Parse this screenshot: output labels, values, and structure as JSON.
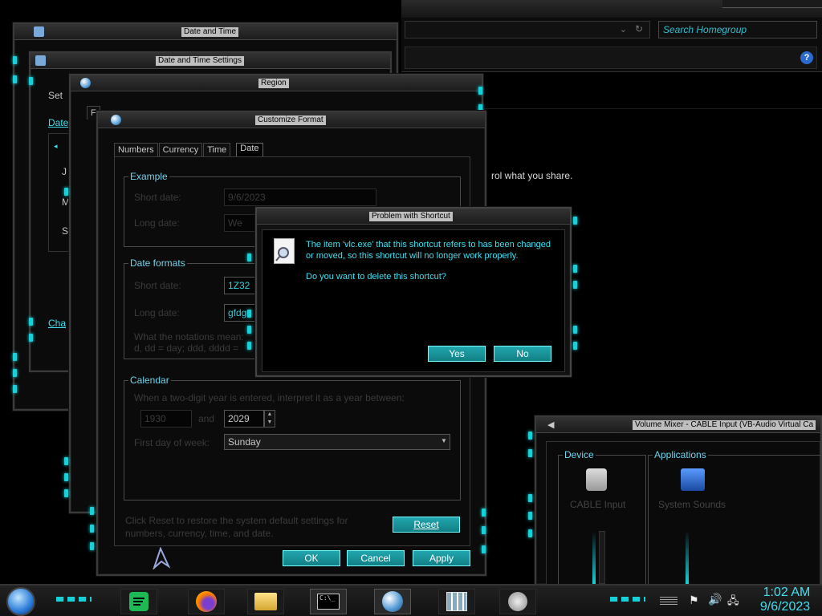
{
  "explorer": {
    "search_placeholder": "Search Homegroup",
    "share_text": "rol what you share."
  },
  "windows": {
    "date_time": {
      "title": "Date and Time"
    },
    "date_time_settings": {
      "title": "Date and Time Settings",
      "left_label_1": "Set",
      "left_label_2": "Date",
      "link_change": "Cha",
      "cal_letters": [
        "J",
        "M",
        "S"
      ]
    },
    "region": {
      "title": "Region",
      "tab_partial": "F"
    },
    "customize_format": {
      "title": "Customize Format",
      "tabs": [
        "Numbers",
        "Currency",
        "Time",
        "Date"
      ],
      "active_tab": "Date",
      "example": {
        "label": "Example",
        "short_date_label": "Short date:",
        "short_date_value": "9/6/2023",
        "long_date_label": "Long date:",
        "long_date_value": "We"
      },
      "formats": {
        "label": "Date formats",
        "short_date_label": "Short date:",
        "short_date_value": "1Z32",
        "long_date_label": "Long date:",
        "long_date_value": "gfdg",
        "notation_1": "What the notations mean:",
        "notation_2": "d, dd = day; ddd, dddd ="
      },
      "calendar": {
        "label": "Calendar",
        "two_digit_text": "When a two-digit year is entered, interpret it as a year between:",
        "year_from": "1930",
        "and_label": "and",
        "year_to": "2029",
        "first_day_label": "First day of week:",
        "first_day_value": "Sunday"
      },
      "reset_hint_1": "Click Reset to restore the system default settings for",
      "reset_hint_2": "numbers, currency, time, and date.",
      "reset_label": "Reset",
      "ok_label": "OK",
      "cancel_label": "Cancel",
      "apply_label": "Apply"
    },
    "problem_dialog": {
      "title": "Problem with Shortcut",
      "line1": "The item 'vlc.exe' that this shortcut refers to has been changed",
      "line2": "or moved, so this shortcut will no longer work properly.",
      "question": "Do you want to delete this shortcut?",
      "yes_label": "Yes",
      "no_label": "No"
    },
    "volume_mixer": {
      "title": "Volume Mixer - CABLE Input (VB-Audio Virtual Ca",
      "device_label": "Device",
      "applications_label": "Applications",
      "device_name": "CABLE Input",
      "app_name": "System Sounds"
    }
  },
  "taskbar": {
    "apps": [
      "spotify-icon",
      "firefox-icon",
      "file-explorer-icon",
      "command-prompt-icon",
      "region-globe-icon",
      "date-time-calendar-icon",
      "speaker-icon"
    ],
    "time": "1:02 AM",
    "date": "9/6/2023"
  },
  "colors": {
    "accent": "#18d0d8",
    "text_cyan": "#3fe0f0",
    "group_title": "#6fd4ee"
  }
}
